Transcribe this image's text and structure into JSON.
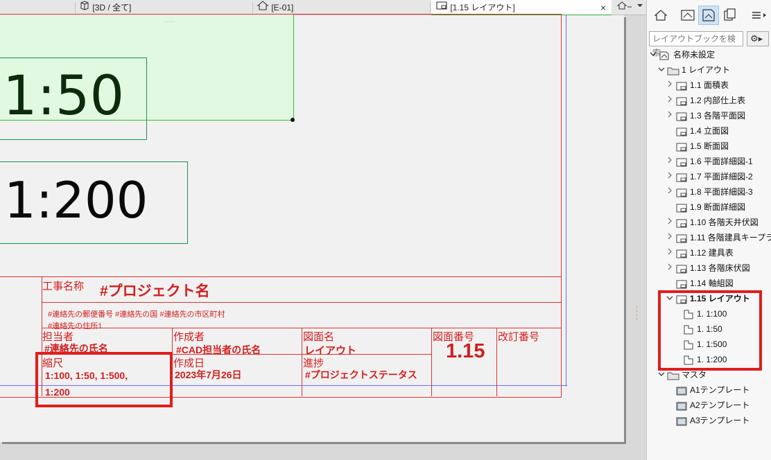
{
  "tabs": [
    {
      "label": "[3D / 全て]",
      "icon": "cube-icon"
    },
    {
      "label": "[E-01]",
      "icon": "house-icon"
    },
    {
      "label": "[1.15 レイアウト]",
      "icon": "layout-icon",
      "active": true
    }
  ],
  "tab_close": "×",
  "canvas": {
    "scale_labels": [
      "1:50",
      "1:200"
    ],
    "dash_mark": "----"
  },
  "title_block": {
    "project_label": "工事名称",
    "project_value": "#プロジェクト名",
    "address_line1": "#連絡先の郵便番号 #連絡先の国 #連絡先の市区町村",
    "address_line2": "#連絡先の住所1",
    "manager_label": "担当者",
    "manager_value": "#連絡先の氏名",
    "author_label": "作成者",
    "author_value": "#CAD担当者の氏名",
    "drawing_name_label": "図面名",
    "drawing_name_value": "レイアウト",
    "drawing_number_label": "図面番号",
    "drawing_number_value": "1.15",
    "revision_label": "改訂番号",
    "scale_label": "縮尺",
    "scale_value_line1": "1:100, 1:50, 1:500,",
    "scale_value_line2": "1:200",
    "date_label": "作成日",
    "date_value": "2023年7月26日",
    "progress_label": "進捗",
    "progress_value": "#プロジェクトステータス"
  },
  "panel": {
    "search_placeholder": "レイアウトブックを検索",
    "gear_label": "⚙▸",
    "tree": [
      {
        "label": "名称未設定",
        "level": 0,
        "chev": "v",
        "icon": "book"
      },
      {
        "label": "1 レイアウト",
        "level": 1,
        "chev": "v",
        "icon": "folder"
      },
      {
        "label": "1.1 面積表",
        "level": 2,
        "chev": ">",
        "icon": "layout"
      },
      {
        "label": "1.2 内部仕上表",
        "level": 2,
        "chev": ">",
        "icon": "layout"
      },
      {
        "label": "1.3 各階平面図",
        "level": 2,
        "chev": ">",
        "icon": "layout"
      },
      {
        "label": "1.4 立面図",
        "level": 2,
        "chev": "",
        "icon": "layout"
      },
      {
        "label": "1.5 断面図",
        "level": 2,
        "chev": "",
        "icon": "layout"
      },
      {
        "label": "1.6 平面詳細図-1",
        "level": 2,
        "chev": ">",
        "icon": "layout"
      },
      {
        "label": "1.7 平面詳細図-2",
        "level": 2,
        "chev": ">",
        "icon": "layout"
      },
      {
        "label": "1.8 平面詳細図-3",
        "level": 2,
        "chev": ">",
        "icon": "layout"
      },
      {
        "label": "1.9 断面詳細図",
        "level": 2,
        "chev": "",
        "icon": "layout"
      },
      {
        "label": "1.10 各階天井伏図",
        "level": 2,
        "chev": ">",
        "icon": "layout"
      },
      {
        "label": "1.11 各階建具キープラ",
        "level": 2,
        "chev": ">",
        "icon": "layout"
      },
      {
        "label": "1.12 建具表",
        "level": 2,
        "chev": ">",
        "icon": "layout"
      },
      {
        "label": "1.13 各階床伏図",
        "level": 2,
        "chev": ">",
        "icon": "layout"
      },
      {
        "label": "1.14 軸組図",
        "level": 2,
        "chev": "",
        "icon": "layout"
      },
      {
        "label": "1.15 レイアウト",
        "level": 2,
        "chev": "v",
        "icon": "layout",
        "bold": true
      },
      {
        "label": "1. 1:100",
        "level": 3,
        "chev": "",
        "icon": "drawing"
      },
      {
        "label": "1. 1:50",
        "level": 3,
        "chev": "",
        "icon": "drawing"
      },
      {
        "label": "1. 1:500",
        "level": 3,
        "chev": "",
        "icon": "drawing"
      },
      {
        "label": "1. 1:200",
        "level": 3,
        "chev": "",
        "icon": "drawing"
      },
      {
        "label": "マスタ",
        "level": 1,
        "chev": "v",
        "icon": "folder"
      },
      {
        "label": "A1テンプレート",
        "level": 2,
        "chev": "",
        "icon": "master"
      },
      {
        "label": "A2テンプレート",
        "level": 2,
        "chev": "",
        "icon": "master"
      },
      {
        "label": "A3テンプレート",
        "level": 2,
        "chev": "",
        "icon": "master"
      }
    ]
  }
}
